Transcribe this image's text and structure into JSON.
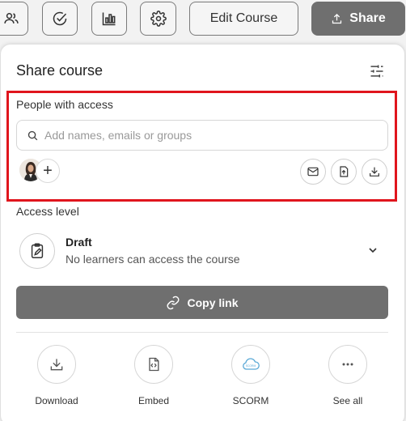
{
  "toolbar": {
    "edit_label": "Edit Course",
    "share_label": "Share",
    "icons": [
      "users-icon",
      "check-circle-icon",
      "bar-chart-icon",
      "gear-icon"
    ]
  },
  "panel": {
    "title": "Share course",
    "people": {
      "label": "People with access",
      "search_placeholder": "Add names, emails or groups",
      "add_symbol": "+"
    },
    "access": {
      "label": "Access level",
      "name": "Draft",
      "description": "No learners can access the course"
    },
    "copy_link_label": "Copy link",
    "actions": [
      {
        "label": "Download",
        "icon": "download-icon"
      },
      {
        "label": "Embed",
        "icon": "embed-icon"
      },
      {
        "label": "SCORM",
        "icon": "scorm-cloud-icon"
      },
      {
        "label": "See all",
        "icon": "more-icon"
      }
    ],
    "scorm_badge": "SCORM"
  },
  "colors": {
    "accent_gray": "#6f6f6f",
    "highlight_red": "#e0151d",
    "scorm_blue": "#5aa9d6"
  }
}
